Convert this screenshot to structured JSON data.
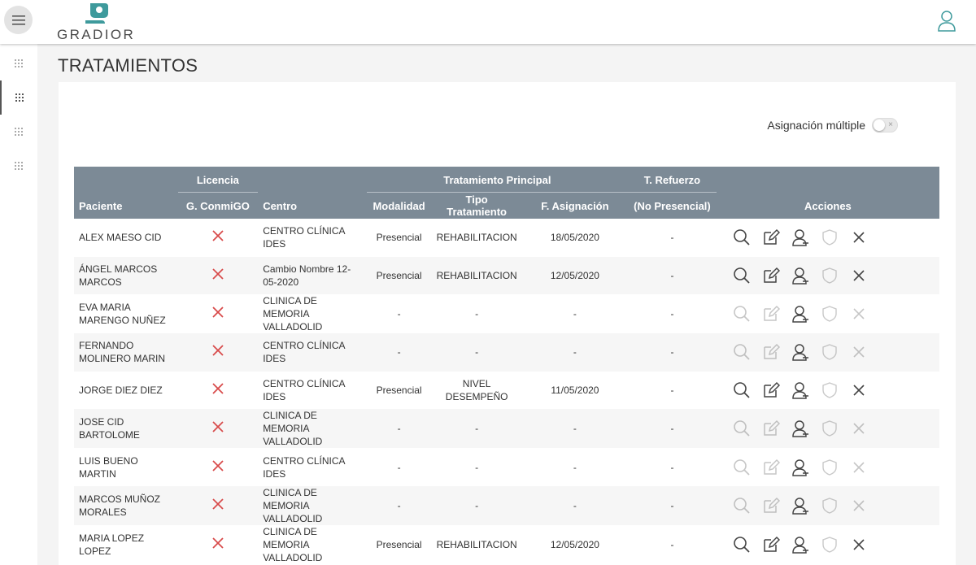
{
  "app": {
    "logo_text": "GRADIOR"
  },
  "page": {
    "title": "TRATAMIENTOS"
  },
  "multi": {
    "label": "Asignación múltiple",
    "off_glyph": "×"
  },
  "table": {
    "group_headers": {
      "licencia": "Licencia",
      "tratamiento": "Tratamiento Principal",
      "refuerzo": "T. Refuerzo"
    },
    "columns": {
      "paciente": "Paciente",
      "conmigo": "G. ConmiGO",
      "centro": "Centro",
      "modalidad": "Modalidad",
      "tipo": "Tipo Tratamiento",
      "fecha": "F. Asignación",
      "no_presencial": "(No Presencial)",
      "acciones": "Acciones"
    },
    "rows": [
      {
        "paciente": "ALEX MAESO CID",
        "centro": "CENTRO CLÍNICA IDES",
        "modalidad": "Presencial",
        "tipo": "REHABILITACION",
        "fecha": "18/05/2020",
        "refuerzo": "-"
      },
      {
        "paciente": "ÁNGEL MARCOS MARCOS",
        "centro": "Cambio Nombre 12-05-2020",
        "modalidad": "Presencial",
        "tipo": "REHABILITACION",
        "fecha": "12/05/2020",
        "refuerzo": "-"
      },
      {
        "paciente": "EVA MARIA MARENGO NUÑEZ",
        "centro": "CLINICA DE MEMORIA VALLADOLID",
        "modalidad": "-",
        "tipo": "-",
        "fecha": "-",
        "refuerzo": "-"
      },
      {
        "paciente": "FERNANDO MOLINERO MARIN",
        "centro": "CENTRO CLÍNICA IDES",
        "modalidad": "-",
        "tipo": "-",
        "fecha": "-",
        "refuerzo": "-"
      },
      {
        "paciente": "JORGE DIEZ DIEZ",
        "centro": "CENTRO CLÍNICA IDES",
        "modalidad": "Presencial",
        "tipo": "NIVEL DESEMPEÑO",
        "fecha": "11/05/2020",
        "refuerzo": "-"
      },
      {
        "paciente": "JOSE CID BARTOLOME",
        "centro": "CLINICA DE MEMORIA VALLADOLID",
        "modalidad": "-",
        "tipo": "-",
        "fecha": "-",
        "refuerzo": "-"
      },
      {
        "paciente": "LUIS BUENO MARTIN",
        "centro": "CENTRO CLÍNICA IDES",
        "modalidad": "-",
        "tipo": "-",
        "fecha": "-",
        "refuerzo": "-"
      },
      {
        "paciente": "MARCOS MUÑOZ MORALES",
        "centro": "CLINICA DE MEMORIA VALLADOLID",
        "modalidad": "-",
        "tipo": "-",
        "fecha": "-",
        "refuerzo": "-"
      },
      {
        "paciente": "MARIA LOPEZ LOPEZ",
        "centro": "CLINICA DE MEMORIA VALLADOLID",
        "modalidad": "Presencial",
        "tipo": "REHABILITACION",
        "fecha": "12/05/2020",
        "refuerzo": "-"
      }
    ]
  },
  "colors": {
    "header_bg": "#7c8a96",
    "logo_teal": "#3e9a9c",
    "red_x": "#d84b4b"
  }
}
